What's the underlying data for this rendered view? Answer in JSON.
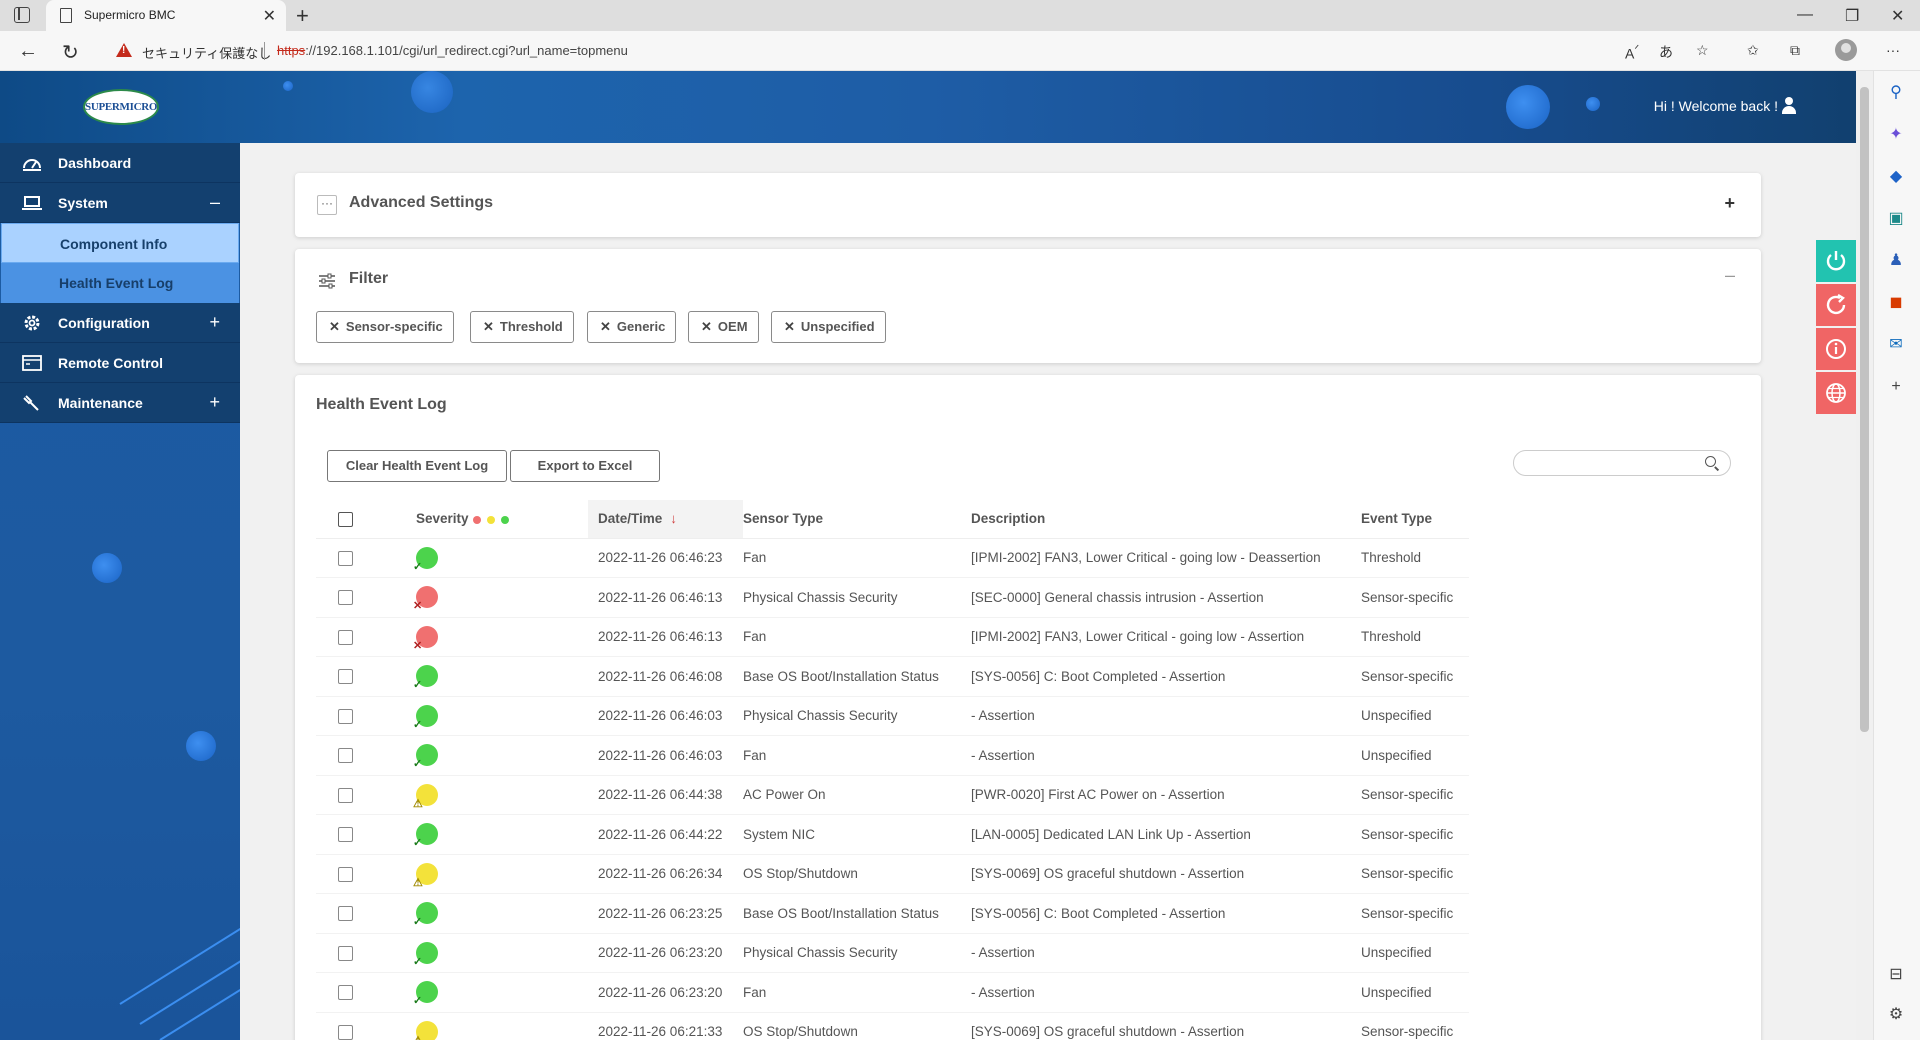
{
  "browser": {
    "tab_title": "Supermicro BMC",
    "security_label": "セキュリティ保護なし",
    "url_protocol": "https",
    "url_rest": "://192.168.1.101/cgi/url_redirect.cgi?url_name=topmenu"
  },
  "header": {
    "logo_text": "SUPERMICRO",
    "welcome": "Hi ! Welcome back !"
  },
  "sidebar": {
    "items": [
      {
        "label": "Dashboard"
      },
      {
        "label": "System",
        "toggle": "–"
      },
      {
        "label": "Configuration",
        "toggle": "+"
      },
      {
        "label": "Remote Control"
      },
      {
        "label": "Maintenance",
        "toggle": "+"
      }
    ],
    "sub_items": [
      {
        "label": "Component Info"
      },
      {
        "label": "Health Event Log"
      }
    ]
  },
  "advanced": {
    "title": "Advanced Settings",
    "toggle": "+"
  },
  "filter": {
    "title": "Filter",
    "toggle": "–",
    "chips": [
      "Sensor-specific",
      "Threshold",
      "Generic",
      "OEM",
      "Unspecified"
    ]
  },
  "log": {
    "title": "Health Event Log",
    "clear_button": "Clear Health Event Log",
    "export_button": "Export to Excel",
    "search_placeholder": "",
    "columns": {
      "severity": "Severity",
      "datetime": "Date/Time",
      "sensor_type": "Sensor Type",
      "description": "Description",
      "event_type": "Event Type"
    },
    "severity_colors": {
      "red": "#f07070",
      "yellow": "#f3e23a",
      "green": "#4cd34c"
    },
    "rows": [
      {
        "severity": "green",
        "datetime": "2022-11-26 06:46:23",
        "sensor_type": "Fan",
        "description": "[IPMI-2002] FAN3, Lower Critical - going low - Deassertion",
        "event_type": "Threshold"
      },
      {
        "severity": "red",
        "datetime": "2022-11-26 06:46:13",
        "sensor_type": "Physical Chassis Security",
        "description": "[SEC-0000] General chassis intrusion - Assertion",
        "event_type": "Sensor-specific"
      },
      {
        "severity": "red",
        "datetime": "2022-11-26 06:46:13",
        "sensor_type": "Fan",
        "description": "[IPMI-2002] FAN3, Lower Critical - going low - Assertion",
        "event_type": "Threshold"
      },
      {
        "severity": "green",
        "datetime": "2022-11-26 06:46:08",
        "sensor_type": "Base OS Boot/Installation Status",
        "description": "[SYS-0056] C: Boot Completed - Assertion",
        "event_type": "Sensor-specific"
      },
      {
        "severity": "green",
        "datetime": "2022-11-26 06:46:03",
        "sensor_type": "Physical Chassis Security",
        "description": "- Assertion",
        "event_type": "Unspecified"
      },
      {
        "severity": "green",
        "datetime": "2022-11-26 06:46:03",
        "sensor_type": "Fan",
        "description": "- Assertion",
        "event_type": "Unspecified"
      },
      {
        "severity": "yellow",
        "datetime": "2022-11-26 06:44:38",
        "sensor_type": "AC Power On",
        "description": "[PWR-0020] First AC Power on - Assertion",
        "event_type": "Sensor-specific"
      },
      {
        "severity": "green",
        "datetime": "2022-11-26 06:44:22",
        "sensor_type": "System NIC",
        "description": "[LAN-0005] Dedicated LAN Link Up - Assertion",
        "event_type": "Sensor-specific"
      },
      {
        "severity": "yellow",
        "datetime": "2022-11-26 06:26:34",
        "sensor_type": "OS Stop/Shutdown",
        "description": "[SYS-0069] OS graceful shutdown - Assertion",
        "event_type": "Sensor-specific"
      },
      {
        "severity": "green",
        "datetime": "2022-11-26 06:23:25",
        "sensor_type": "Base OS Boot/Installation Status",
        "description": "[SYS-0056] C: Boot Completed - Assertion",
        "event_type": "Sensor-specific"
      },
      {
        "severity": "green",
        "datetime": "2022-11-26 06:23:20",
        "sensor_type": "Physical Chassis Security",
        "description": "- Assertion",
        "event_type": "Unspecified"
      },
      {
        "severity": "green",
        "datetime": "2022-11-26 06:23:20",
        "sensor_type": "Fan",
        "description": "- Assertion",
        "event_type": "Unspecified"
      },
      {
        "severity": "yellow",
        "datetime": "2022-11-26 06:21:33",
        "sensor_type": "OS Stop/Shutdown",
        "description": "[SYS-0069] OS graceful shutdown - Assertion",
        "event_type": "Sensor-specific"
      }
    ]
  },
  "actions": [
    {
      "icon": "power-icon",
      "color": "#22c3b0"
    },
    {
      "icon": "refresh-icon",
      "color": "#f06565"
    },
    {
      "icon": "info-icon",
      "color": "#f06565"
    },
    {
      "icon": "globe-icon",
      "color": "#f06565"
    }
  ]
}
